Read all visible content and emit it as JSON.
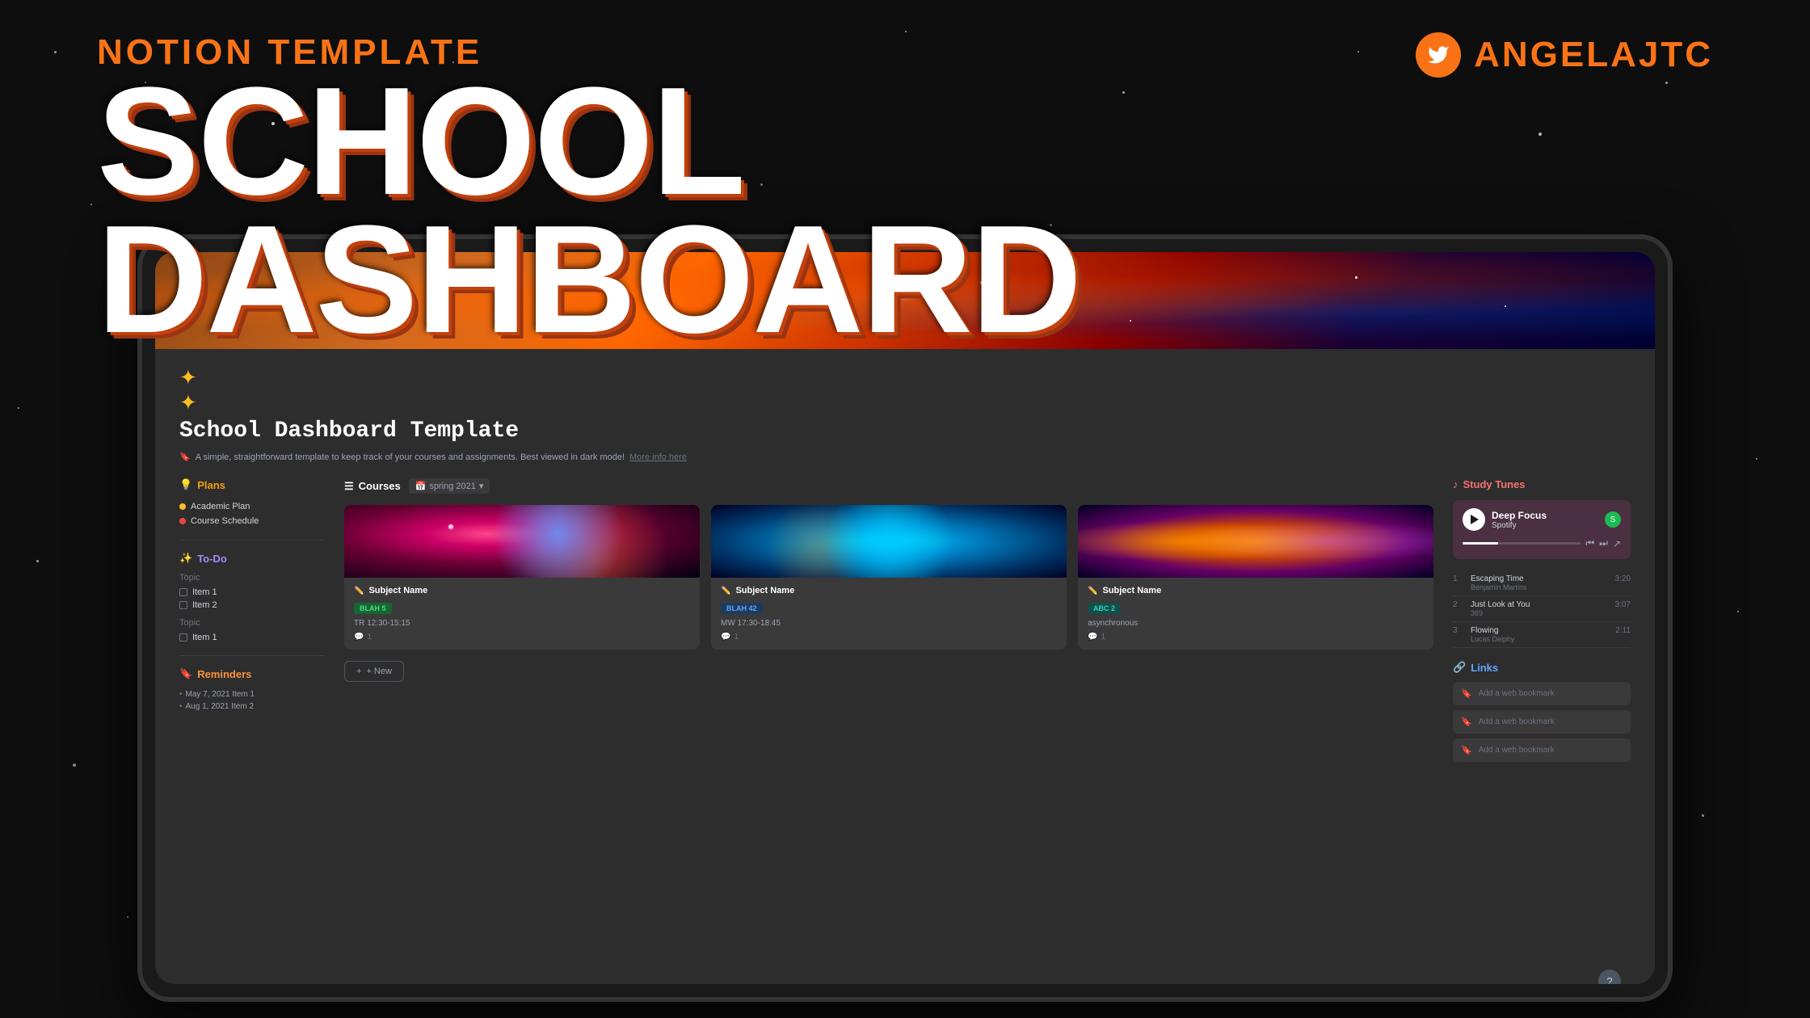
{
  "page": {
    "background_color": "#0e0e0e"
  },
  "header": {
    "notion_label": "NOTION TEMPLATE",
    "title": "SCHOOL DASHBOARD",
    "twitter_handle": "ANGELAJTC"
  },
  "notion_page": {
    "sparkle_emoji": "✦✦",
    "title": "School Dashboard Template",
    "subtitle": "A simple, straightforward template to keep track of your courses and assignments. Best viewed in dark mode!",
    "subtitle_link": "More info here",
    "plans_section": {
      "heading": "Plans",
      "items": [
        {
          "label": "Academic Plan",
          "dot_color": "yellow"
        },
        {
          "label": "Course Schedule",
          "dot_color": "red"
        }
      ]
    },
    "todo_section": {
      "heading": "To-Do",
      "groups": [
        {
          "topic": "Topic",
          "items": [
            "Item 1",
            "Item 2"
          ]
        },
        {
          "topic": "Topic",
          "items": [
            "Item 1"
          ]
        }
      ]
    },
    "reminders_section": {
      "heading": "Reminders",
      "items": [
        "May 7, 2021  Item 1",
        "Aug 1, 2021  Item 2"
      ]
    },
    "courses_section": {
      "heading": "Courses",
      "filter_label": "spring 2021",
      "courses": [
        {
          "name": "Subject Name",
          "tag": "BLAH 5",
          "tag_class": "tag-green",
          "schedule": "TR 12:30-15:15",
          "comment_count": "1",
          "nebula_class": "nebula1"
        },
        {
          "name": "Subject Name",
          "tag": "BLAH 42",
          "tag_class": "tag-blue",
          "schedule": "MW 17:30-18:45",
          "comment_count": "1",
          "nebula_class": "nebula2"
        },
        {
          "name": "Subject Name",
          "tag": "ABC 2",
          "tag_class": "tag-teal",
          "schedule": "asynchronous",
          "comment_count": "1",
          "nebula_class": "nebula3"
        }
      ],
      "new_button": "+ New"
    },
    "study_tunes": {
      "heading": "Study Tunes",
      "player": {
        "playlist_name": "Deep Focus",
        "app": "Spotify",
        "progress_percent": 30
      },
      "tracks": [
        {
          "num": "1",
          "name": "Escaping Time",
          "artist": "Benjamin Martins",
          "duration": "3:20"
        },
        {
          "num": "2",
          "name": "Just Look at You",
          "artist": "369",
          "duration": "3:07"
        },
        {
          "num": "3",
          "name": "Flowing",
          "artist": "Lucas Delphy",
          "duration": "2:11"
        }
      ]
    },
    "links_section": {
      "heading": "Links",
      "bookmarks": [
        "Add a web bookmark",
        "Add a web bookmark",
        "Add a web bookmark"
      ]
    },
    "help_label": "?"
  }
}
